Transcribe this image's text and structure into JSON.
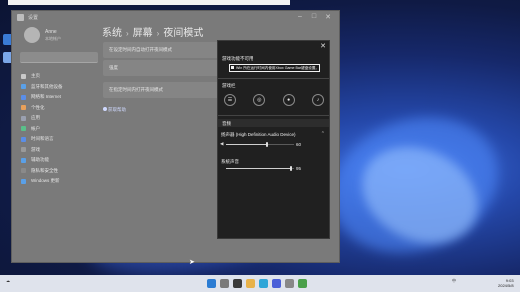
{
  "settings_window": {
    "title": "设置",
    "user": {
      "name": "Anne",
      "subtitle": "本地帐户"
    },
    "breadcrumb": [
      "系统",
      "屏幕",
      "夜间模式"
    ],
    "nav_items": [
      {
        "label": "主页",
        "icon": "home-icon",
        "color": "#c9c9c9"
      },
      {
        "label": "蓝牙和其他设备",
        "icon": "bluetooth-icon",
        "color": "#5aa0e8"
      },
      {
        "label": "网络和 Internet",
        "icon": "wifi-icon",
        "color": "#5a8ee8"
      },
      {
        "label": "个性化",
        "icon": "brush-icon",
        "color": "#e8a05a"
      },
      {
        "label": "应用",
        "icon": "apps-icon",
        "color": "#9aa0b0"
      },
      {
        "label": "帐户",
        "icon": "person-icon",
        "color": "#5ac08a"
      },
      {
        "label": "时间和语言",
        "icon": "clock-icon",
        "color": "#5a8ee8"
      },
      {
        "label": "游戏",
        "icon": "gamepad-icon",
        "color": "#9a9a9a"
      },
      {
        "label": "辅助功能",
        "icon": "accessibility-icon",
        "color": "#5aa0e8"
      },
      {
        "label": "隐私和安全性",
        "icon": "shield-icon",
        "color": "#8a8a8a"
      },
      {
        "label": "Windows 更新",
        "icon": "update-icon",
        "color": "#5aa0e8"
      }
    ],
    "rows": [
      {
        "label": "在设定时间内自动打开夜间模式"
      },
      {
        "label": "强度"
      },
      {
        "label": "在指定时间内打开夜间模式"
      }
    ],
    "help_link": "获取帮助"
  },
  "quick_settings": {
    "warning_title": "游戏功能不可用",
    "tooltip": "Win 所在运行时间内使用Xbox Game Bar键盘设置。",
    "section_game_bar": "游戏栏",
    "section_sound": "音频",
    "buttons": [
      {
        "icon": "menu-icon",
        "glyph": "☰"
      },
      {
        "icon": "capture-icon",
        "glyph": "◎"
      },
      {
        "icon": "record-icon",
        "glyph": "●"
      },
      {
        "icon": "mic-icon",
        "glyph": "♪"
      }
    ],
    "device_label": "扬声器 (High Definition Audio Device)",
    "device_volume": "60",
    "system_label": "系统声音",
    "system_volume": "95",
    "extra_label": "1"
  },
  "taskbar": {
    "time": "9:03",
    "date": "2024/5/8",
    "tray_label": "中"
  }
}
